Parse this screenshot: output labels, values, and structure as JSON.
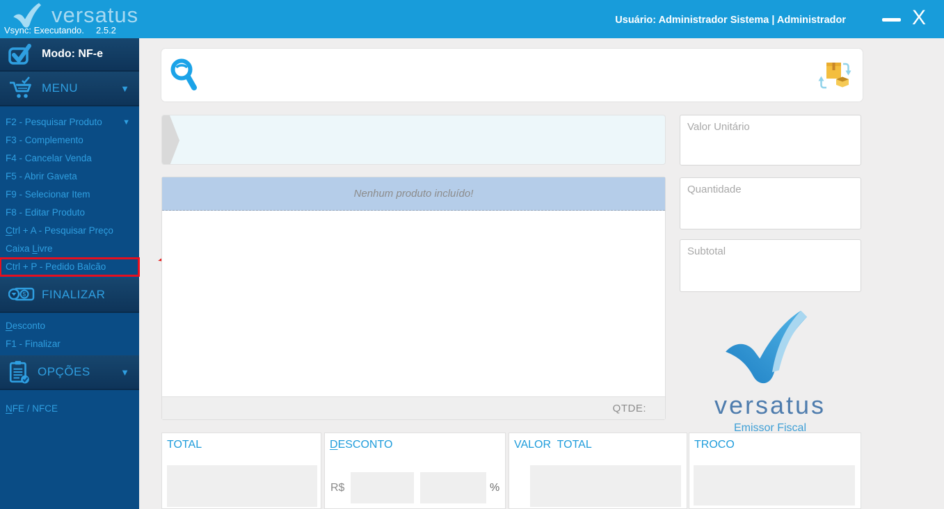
{
  "colors": {
    "topbar_blue": "#189CDA",
    "sidebar_bg": "#0A4C85",
    "sidebar_link": "#2F9FE1",
    "annotation_red": "#E60F1E",
    "banner_blue": "#B5CDE9",
    "totals_label_blue": "#1E9CDB"
  },
  "titlebar": {
    "logo_text": "versatus",
    "vsync_status": "Vsync: Executando.",
    "version": "2.5.2",
    "user_info": "Usuário: Administrador Sistema | Administrador",
    "close_glyph": "X"
  },
  "sidebar": {
    "mode_label": "Modo: NF-e",
    "menu": {
      "title": "MENU",
      "items": [
        {
          "label": "F2 - Pesquisar Produto"
        },
        {
          "label": "F3 - Complemento"
        },
        {
          "label": "F4 - Cancelar Venda"
        },
        {
          "label": "F5 - Abrir Gaveta"
        },
        {
          "label": "F9 - Selecionar Item"
        },
        {
          "label": "F8 - Editar Produto"
        },
        {
          "label": "Ctrl + A - Pesquisar Preço",
          "accel": "C"
        },
        {
          "label": "Caixa Livre",
          "accel": "L"
        },
        {
          "label": "Ctrl + P - Pedido Balcão"
        }
      ]
    },
    "finalizar": {
      "title": "FINALIZAR",
      "items": [
        {
          "label": "Desconto",
          "accel": "D"
        },
        {
          "label": "F1 - Finalizar"
        }
      ]
    },
    "opcoes": {
      "title": "OPÇÕES",
      "items": [
        {
          "label": "NFE / NFCE",
          "accel": "N"
        }
      ]
    }
  },
  "main": {
    "empty_list_message": "Nenhum produto incluído!",
    "qtde_label": "QTDE:",
    "fields": {
      "valor_unitario": "Valor Unitário",
      "quantidade": "Quantidade",
      "subtotal": "Subtotal"
    },
    "watermark": {
      "brand": "versatus",
      "tagline": "Emissor Fiscal"
    },
    "totals": {
      "total_label": "TOTAL",
      "desconto": {
        "label": "DESCONTO",
        "accel": "D"
      },
      "currency_label": "R$",
      "percent_label": "%",
      "valor_total_label": "VALOR  TOTAL",
      "troco_label": "TROCO"
    }
  }
}
